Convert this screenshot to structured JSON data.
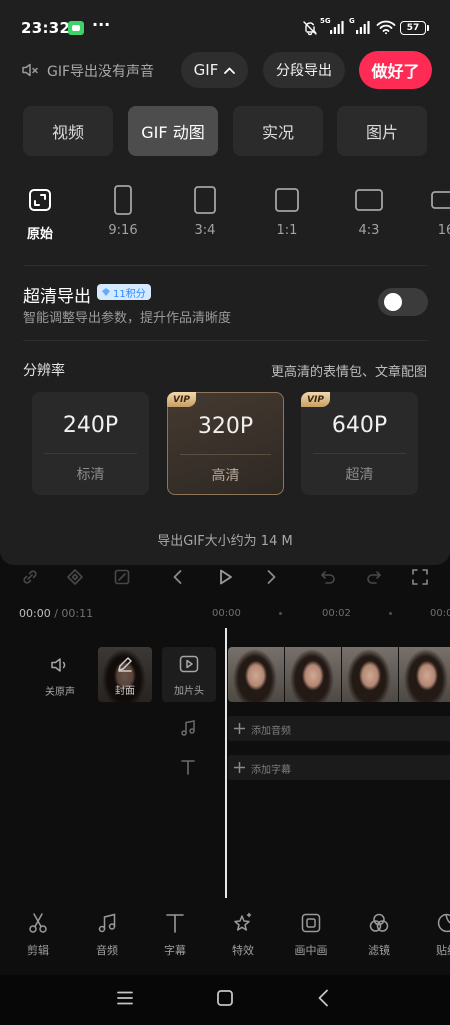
{
  "status_bar": {
    "time": "23:32",
    "more": "···",
    "network_1": "5G",
    "network_2": "G",
    "battery": "57"
  },
  "header": {
    "audio_notice": "GIF导出没有声音",
    "format_button": "GIF",
    "segment_export_button": "分段导出",
    "done_button": "做好了"
  },
  "export_tabs": [
    {
      "label": "视频",
      "selected": false
    },
    {
      "label": "GIF 动图",
      "selected": true
    },
    {
      "label": "实况",
      "selected": false
    },
    {
      "label": "图片",
      "selected": false
    }
  ],
  "aspect_ratios": [
    {
      "label": "原始",
      "icon": "original-ratio-icon",
      "selected": true
    },
    {
      "label": "9:16",
      "icon": "ratio-9-16-icon",
      "selected": false
    },
    {
      "label": "3:4",
      "icon": "ratio-3-4-icon",
      "selected": false
    },
    {
      "label": "1:1",
      "icon": "ratio-1-1-icon",
      "selected": false
    },
    {
      "label": "4:3",
      "icon": "ratio-4-3-icon",
      "selected": false
    },
    {
      "label": "16",
      "icon": "ratio-16-9-icon",
      "selected": false
    }
  ],
  "hd_export": {
    "title": "超清导出",
    "badge": "11积分",
    "badge_icon": "diamond-icon",
    "description": "智能调整导出参数，提升作品清晰度",
    "enabled": false
  },
  "resolution": {
    "title": "分辨率",
    "hint": "更高清的表情包、文章配图",
    "vip_badge": "VIP",
    "options": [
      {
        "value": "240P",
        "label": "标清",
        "vip": false,
        "selected": false
      },
      {
        "value": "320P",
        "label": "高清",
        "vip": true,
        "selected": true
      },
      {
        "value": "640P",
        "label": "超清",
        "vip": true,
        "selected": false
      }
    ]
  },
  "size_estimate": "导出GIF大小约为 14 M",
  "editor": {
    "time_current": "00:00",
    "time_total": "/ 00:11",
    "ruler": [
      "00:00",
      "00:02",
      "00:0"
    ],
    "toolbar_icons": [
      "link-icon",
      "keyframe-diamond-icon",
      "crop-icon",
      "previous-icon",
      "play-icon",
      "next-icon",
      "undo-icon",
      "redo-icon",
      "fullscreen-icon"
    ]
  },
  "tracks": {
    "mute_original": "关原声",
    "cover": "封面",
    "add_intro": "加片头",
    "add_audio": "添加音频",
    "add_subtitle": "添加字幕"
  },
  "bottom_toolbar": [
    {
      "label": "剪辑",
      "icon": "scissors-icon"
    },
    {
      "label": "音频",
      "icon": "music-note-icon"
    },
    {
      "label": "字幕",
      "icon": "text-icon"
    },
    {
      "label": "特效",
      "icon": "sparkle-star-icon"
    },
    {
      "label": "画中画",
      "icon": "picture-in-picture-icon"
    },
    {
      "label": "滤镜",
      "icon": "filter-icon"
    },
    {
      "label": "贴纸",
      "icon": "sticker-icon"
    }
  ],
  "nav_bar": {
    "icons": [
      "menu-icon",
      "home-icon",
      "back-icon"
    ]
  },
  "colors": {
    "accent": "#fe2c55",
    "vip_gold": "#d8b07a",
    "badge_blue": "#2f87ff",
    "selected_card_border": "#8d765a",
    "sheet_background": "#1f1f1f"
  }
}
